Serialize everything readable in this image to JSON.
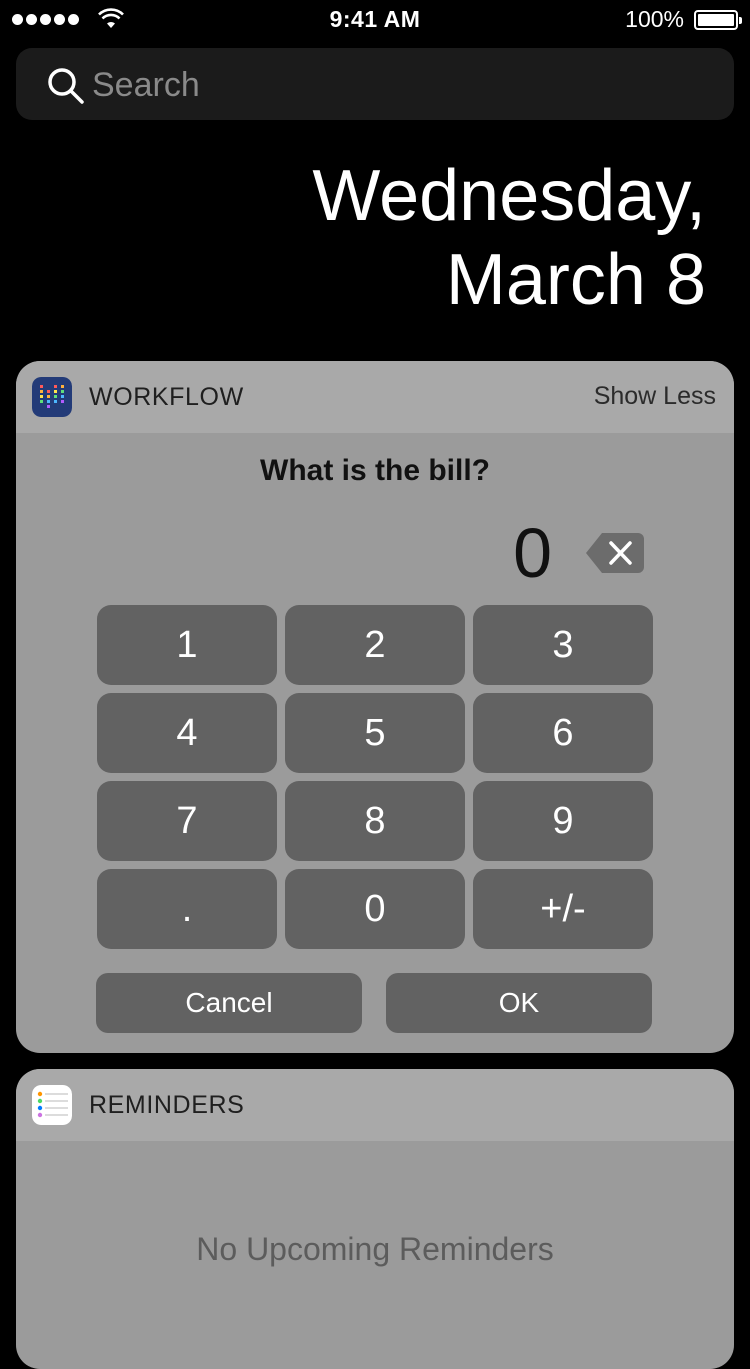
{
  "status_bar": {
    "time": "9:41 AM",
    "battery_percent": "100%",
    "signal_bars": 5
  },
  "search": {
    "placeholder": "Search"
  },
  "date": {
    "line1": "Wednesday,",
    "line2": "March 8"
  },
  "workflow_widget": {
    "title": "WORKFLOW",
    "show_less_label": "Show Less",
    "prompt": "What is the bill?",
    "display_value": "0",
    "keys": [
      "1",
      "2",
      "3",
      "4",
      "5",
      "6",
      "7",
      "8",
      "9",
      ".",
      "0",
      "+/-"
    ],
    "cancel_label": "Cancel",
    "ok_label": "OK"
  },
  "reminders_widget": {
    "title": "REMINDERS",
    "empty_message": "No Upcoming Reminders"
  }
}
